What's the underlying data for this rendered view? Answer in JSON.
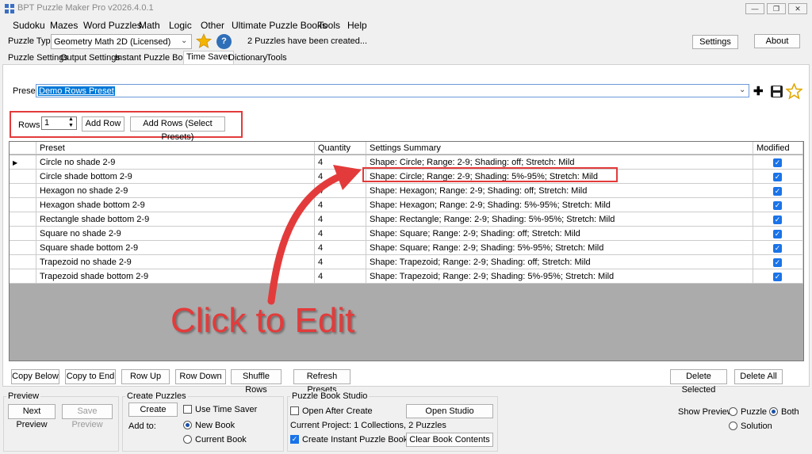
{
  "window": {
    "title": "BPT Puzzle Maker Pro v2026.4.0.1",
    "min": "—",
    "restore": "❐",
    "close": "✕"
  },
  "menu": [
    "Sudoku",
    "Mazes",
    "Word Puzzles",
    "Math",
    "Logic",
    "Other",
    "Ultimate Puzzle Books",
    "Tools",
    "Help"
  ],
  "toolbar": {
    "puzzle_type_label": "Puzzle Type",
    "puzzle_type_value": "Geometry Math 2D (Licensed)",
    "help_glyph": "?",
    "status": "2 Puzzles have been created...",
    "settings": "Settings",
    "about": "About"
  },
  "tabs": [
    "Puzzle Settings",
    "Output Settings",
    "Instant Puzzle Books",
    "Time Saver",
    "Dictionary",
    "Tools"
  ],
  "active_tab": "Time Saver",
  "preset": {
    "label": "Preset",
    "value": "Demo Rows Preset",
    "add_glyph": "✚",
    "save_glyph": "💾",
    "star_glyph": "☆"
  },
  "rows_control": {
    "label": "Rows",
    "value": "1",
    "add_row": "Add Row",
    "add_rows_select": "Add Rows (Select Presets)"
  },
  "grid": {
    "headers": [
      "Preset",
      "Quantity",
      "Settings Summary",
      "Modified"
    ],
    "rows": [
      {
        "preset": "Circle no shade 2-9",
        "quantity": "4",
        "summary": "Shape: Circle; Range: 2-9; Shading: off; Stretch: Mild",
        "modified": true
      },
      {
        "preset": "Circle shade bottom 2-9",
        "quantity": "4",
        "summary": "Shape: Circle; Range: 2-9; Shading: 5%-95%; Stretch: Mild",
        "modified": true
      },
      {
        "preset": "Hexagon no shade 2-9",
        "quantity": "4",
        "summary": "Shape: Hexagon; Range: 2-9; Shading: off; Stretch: Mild",
        "modified": true
      },
      {
        "preset": "Hexagon shade bottom 2-9",
        "quantity": "4",
        "summary": "Shape: Hexagon; Range: 2-9; Shading: 5%-95%; Stretch: Mild",
        "modified": true
      },
      {
        "preset": "Rectangle shade bottom 2-9",
        "quantity": "4",
        "summary": "Shape: Rectangle; Range: 2-9; Shading: 5%-95%; Stretch: Mild",
        "modified": true
      },
      {
        "preset": "Square no shade 2-9",
        "quantity": "4",
        "summary": "Shape: Square; Range: 2-9; Shading: off; Stretch: Mild",
        "modified": true
      },
      {
        "preset": "Square shade bottom 2-9",
        "quantity": "4",
        "summary": "Shape: Square; Range: 2-9; Shading: 5%-95%; Stretch: Mild",
        "modified": true
      },
      {
        "preset": "Trapezoid no shade 2-9",
        "quantity": "4",
        "summary": "Shape: Trapezoid; Range: 2-9; Shading: off; Stretch: Mild",
        "modified": true
      },
      {
        "preset": "Trapezoid shade bottom 2-9",
        "quantity": "4",
        "summary": "Shape: Trapezoid; Range: 2-9; Shading: 5%-95%; Stretch: Mild",
        "modified": true
      }
    ]
  },
  "grid_buttons": {
    "copy_below": "Copy Below",
    "copy_to_end": "Copy to End",
    "row_up": "Row Up",
    "row_down": "Row Down",
    "shuffle_rows": "Shuffle Rows",
    "refresh_presets": "Refresh Presets",
    "delete_selected": "Delete Selected",
    "delete_all": "Delete All"
  },
  "preview_group": {
    "title": "Preview",
    "next_preview": "Next Preview",
    "save_preview": "Save Preview"
  },
  "create_group": {
    "title": "Create Puzzles",
    "create": "Create",
    "use_time_saver": "Use Time Saver",
    "add_to": "Add to:",
    "new_book": "New Book",
    "current_book": "Current Book"
  },
  "studio_group": {
    "title": "Puzzle Book Studio",
    "open_after_create": "Open After Create",
    "open_studio": "Open Studio",
    "current_project": "Current Project: 1 Collections, 2 Puzzles",
    "create_instant": "Create Instant Puzzle Book",
    "clear_book": "Clear Book Contents"
  },
  "show_preview": {
    "label": "Show Preview:",
    "puzzle": "Puzzle",
    "both": "Both",
    "solution": "Solution",
    "selected": "Both"
  },
  "annotation": {
    "text": "Click to Edit",
    "color": "#e33b3b"
  },
  "colors": {
    "accent": "#0078d7",
    "star": "#f4b400",
    "highlight_box": "#e33b3b"
  }
}
